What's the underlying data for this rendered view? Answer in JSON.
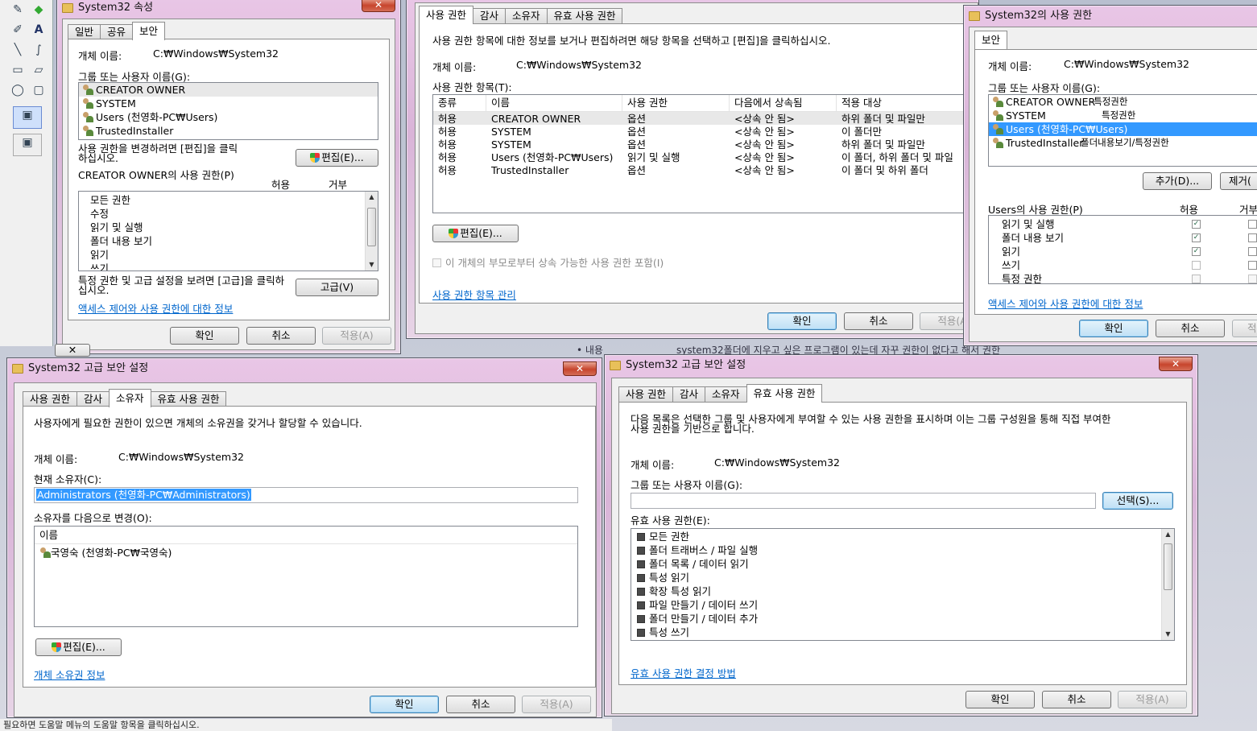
{
  "win1": {
    "title": "System32 속성",
    "tabs": [
      "일반",
      "공유",
      "보안"
    ],
    "object_label": "개체 이름:",
    "object_value": "C:₩Windows₩System32",
    "group_label": "그룹 또는 사용자 이름(G):",
    "users": [
      "CREATOR OWNER",
      "SYSTEM",
      "Users (천영화-PC₩Users)",
      "TrustedInstaller"
    ],
    "change_text": "사용 권한을 변경하려면 [편집]을 클릭하십시오.",
    "edit_btn": "편집(E)...",
    "perm_label": "CREATOR OWNER의 사용 권한(P)",
    "allow": "허용",
    "deny": "거부",
    "perms": [
      "모든 권한",
      "수정",
      "읽기 및 실행",
      "폴더 내용 보기",
      "읽기",
      "쓰기"
    ],
    "adv_text": "특정 권한 및 고급 설정을 보려면 [고급]을 클릭하십시오.",
    "adv_btn": "고급(V)",
    "link": "액세스 제어와 사용 권한에 대한 정보",
    "ok": "확인",
    "cancel": "취소",
    "apply": "적용(A)"
  },
  "win2": {
    "tabs": [
      "사용 권한",
      "감사",
      "소유자",
      "유효 사용 권한"
    ],
    "desc": "사용 권한 항목에 대한 정보를 보거나 편집하려면 해당 항목을 선택하고 [편집]을 클릭하십시오.",
    "object_label": "개체 이름:",
    "object_value": "C:₩Windows₩System32",
    "entries_label": "사용 권한 항목(T):",
    "columns": [
      "종류",
      "이름",
      "사용 권한",
      "다음에서 상속됨",
      "적용 대상"
    ],
    "rows": [
      [
        "허용",
        "CREATOR OWNER",
        "옵션",
        "<상속 안 됨>",
        "하위 폴더 및 파일만"
      ],
      [
        "허용",
        "SYSTEM",
        "옵션",
        "<상속 안 됨>",
        "이 폴더만"
      ],
      [
        "허용",
        "SYSTEM",
        "옵션",
        "<상속 안 됨>",
        "하위 폴더 및 파일만"
      ],
      [
        "허용",
        "Users (천영화-PC₩Users)",
        "읽기 및 실행",
        "<상속 안 됨>",
        "이 폴더, 하위 폴더 및 파일"
      ],
      [
        "허용",
        "TrustedInstaller",
        "옵션",
        "<상속 안 됨>",
        "이 폴더 및 하위 폴더"
      ]
    ],
    "edit_btn": "편집(E)...",
    "inherit_check": "이 개체의 부모로부터 상속 가능한 사용 권한 포함(I)",
    "link": "사용 권한 항목 관리",
    "ok": "확인",
    "cancel": "취소",
    "apply": "적용(A)"
  },
  "win3": {
    "title": "System32의 사용 권한",
    "tab": "보안",
    "object_label": "개체 이름:",
    "object_value": "C:₩Windows₩System32",
    "group_label": "그룹 또는 사용자 이름(G):",
    "users": [
      {
        "name": "CREATOR OWNER",
        "note": "-특정권한"
      },
      {
        "name": "SYSTEM",
        "note": "특정권한"
      },
      {
        "name": "Users (천영화-PC₩Users)",
        "note": ""
      },
      {
        "name": "TrustedInstaller",
        "note": "폴더내용보기/특정권한"
      }
    ],
    "add_btn": "추가(D)...",
    "remove_btn": "제거(",
    "perm_label": "Users의 사용 권한(P)",
    "allow": "허용",
    "deny": "거부",
    "perms": [
      {
        "name": "읽기 및 실행",
        "allow": true
      },
      {
        "name": "폴더 내용 보기",
        "allow": true
      },
      {
        "name": "읽기",
        "allow": true
      },
      {
        "name": "쓰기",
        "allow": false
      },
      {
        "name": "특정 권한",
        "allow": false
      }
    ],
    "link": "액세스 제어와 사용 권한에 대한 정보",
    "ok": "확인",
    "cancel": "취소",
    "apply": "적"
  },
  "win4": {
    "title": "System32 고급 보안 설정",
    "tabs": [
      "사용 권한",
      "감사",
      "소유자",
      "유효 사용 권한"
    ],
    "desc": "사용자에게 필요한 권한이 있으면 개체의 소유권을 갖거나 할당할 수 있습니다.",
    "object_label": "개체 이름:",
    "object_value": "C:₩Windows₩System32",
    "current_owner_label": "현재 소유자(C):",
    "current_owner": "Administrators (천영화-PC₩Administrators)",
    "change_label": "소유자를 다음으로 변경(O):",
    "col_name": "이름",
    "candidates": [
      "국영숙 (천영화-PC₩국영숙)"
    ],
    "edit_btn": "편집(E)...",
    "link": "개체 소유권 정보",
    "ok": "확인",
    "cancel": "취소",
    "apply": "적용(A)"
  },
  "win5": {
    "title": "System32 고급 보안 설정",
    "tabs": [
      "사용 권한",
      "감사",
      "소유자",
      "유효 사용 권한"
    ],
    "desc1": "다음 목록은 선택한 그룹 및 사용자에게 부여할 수 있는 사용 권한을 표시하며 이는 그룹 구성원을 통해 직접 부여한",
    "desc2": "사용 권한을 기반으로 합니다.",
    "object_label": "개체 이름:",
    "object_value": "C:₩Windows₩System32",
    "group_label": "그룹 또는 사용자 이름(G):",
    "select_btn": "선택(S)...",
    "eff_label": "유효 사용 권한(E):",
    "perms": [
      "모든 권한",
      "폴더 트래버스 / 파일 실행",
      "폴더 목록 / 데이터 읽기",
      "특성 읽기",
      "확장 특성 읽기",
      "파일 만들기 / 데이터 쓰기",
      "폴더 만들기 / 데이터 추가",
      "특성 쓰기"
    ],
    "link": "유효 사용 권한 결정 방법",
    "ok": "확인",
    "cancel": "취소",
    "apply": "적용(A)"
  },
  "background": {
    "bullet": "• 내용",
    "line1": "system32폴더에 지우고 싶은 프로그램이 있는데 자꾸 권한이 없다고 해서 권한",
    "status": "필요하면 도움말 메뉴의 도움말 항목을 클릭하십시오."
  },
  "colors": {
    "accent": "#3399ff",
    "link": "#0066cc",
    "frame": "#d9b4d8"
  }
}
